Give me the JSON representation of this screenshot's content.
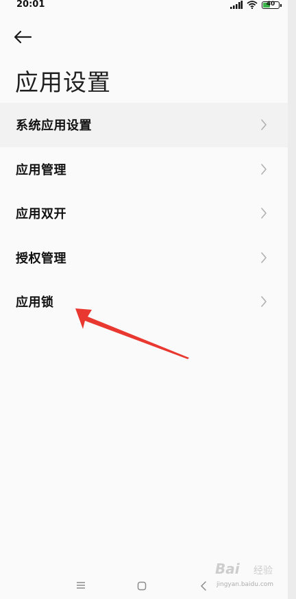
{
  "status_bar": {
    "time": "20:01",
    "battery_level": "40",
    "icons": [
      "signal-icon",
      "wifi-icon",
      "battery-icon"
    ]
  },
  "header": {
    "back_icon": "arrow-left-icon",
    "title": "应用设置"
  },
  "list": {
    "items": [
      {
        "label": "系统应用设置",
        "icon": "chevron-right-icon"
      },
      {
        "label": "应用管理",
        "icon": "chevron-right-icon"
      },
      {
        "label": "应用双开",
        "icon": "chevron-right-icon"
      },
      {
        "label": "授权管理",
        "icon": "chevron-right-icon"
      },
      {
        "label": "应用锁",
        "icon": "chevron-right-icon"
      }
    ]
  },
  "annotation": {
    "color": "#e8382f",
    "points_to": "应用锁"
  },
  "nav_bar": {
    "buttons": [
      "menu-icon",
      "home-icon",
      "back-icon"
    ]
  },
  "watermark": {
    "brand": "Bai",
    "sub": "经验",
    "url": "jingyan.baidu.com"
  },
  "colors": {
    "background": "#fafafa",
    "text": "#111111",
    "chevron": "#b0b0b0",
    "battery_fill": "#3bb54a"
  }
}
